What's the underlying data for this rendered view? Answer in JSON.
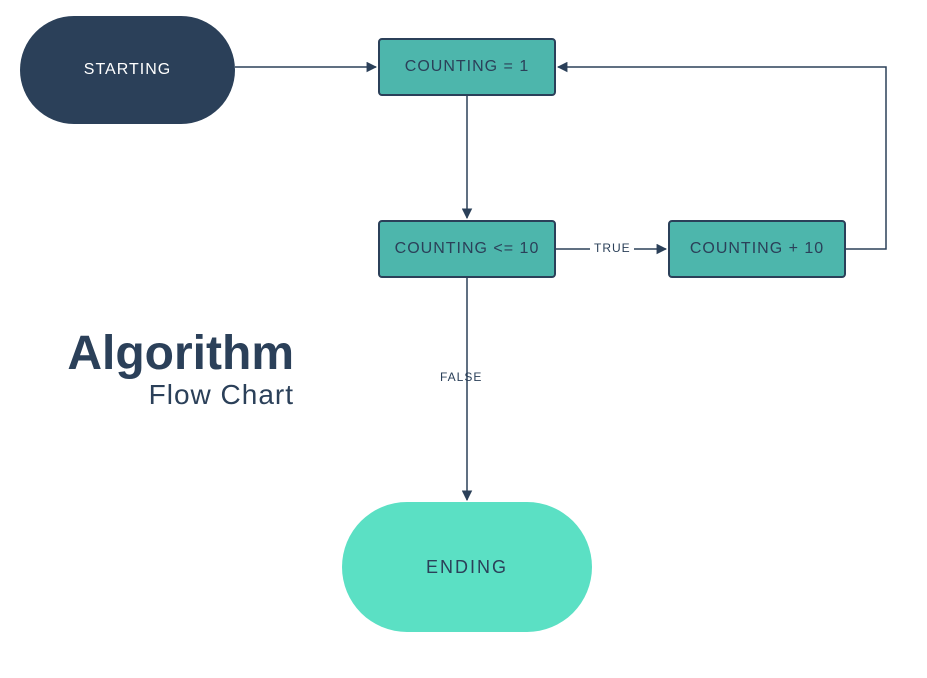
{
  "title": {
    "main": "Algorithm",
    "sub": "Flow Chart"
  },
  "nodes": {
    "start": {
      "label": "STARTING"
    },
    "init": {
      "label": "COUNTING = 1"
    },
    "cond": {
      "label": "COUNTING <= 10"
    },
    "inc": {
      "label": "COUNTING + 10"
    },
    "end": {
      "label": "ENDING"
    }
  },
  "edges": {
    "cond_true": {
      "label": "TRUE"
    },
    "cond_false": {
      "label": "FALSE"
    }
  },
  "colors": {
    "dark": "#2b4059",
    "teal": "#4db6ac",
    "mint": "#5be0c4"
  }
}
